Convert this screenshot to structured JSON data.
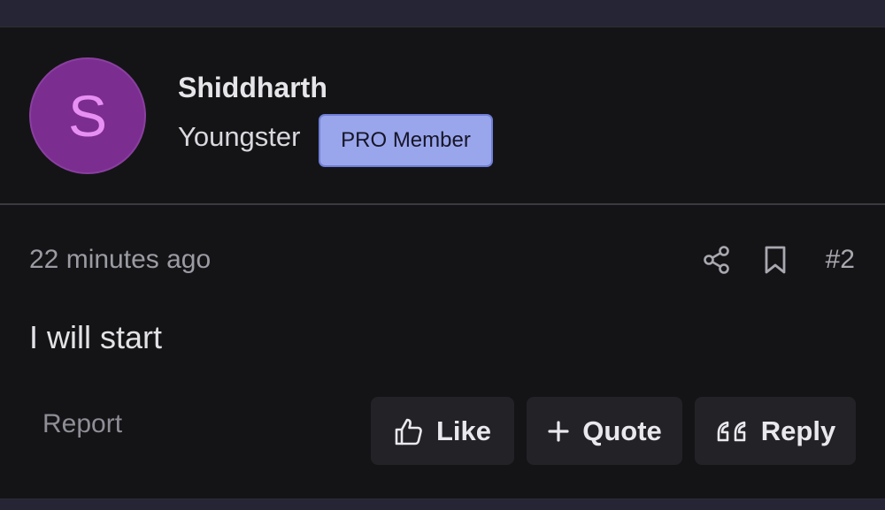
{
  "post": {
    "author": {
      "initial": "S",
      "name": "Shiddharth",
      "title": "Youngster",
      "badge": "PRO Member"
    },
    "timestamp": "22 minutes ago",
    "number": "#2",
    "body": "I will start",
    "report_label": "Report",
    "actions": {
      "like": "Like",
      "quote": "Quote",
      "reply": "Reply"
    }
  },
  "icons": {
    "share": "share-icon",
    "bookmark": "bookmark-icon",
    "like": "thumbs-up-icon",
    "quote": "plus-icon",
    "reply": "quote-marks-icon"
  },
  "colors": {
    "avatar_bg": "#7b2d90",
    "avatar_letter": "#e88ff3",
    "badge_bg": "#9aa6ec",
    "card_bg": "#141416",
    "button_bg": "#232327"
  }
}
